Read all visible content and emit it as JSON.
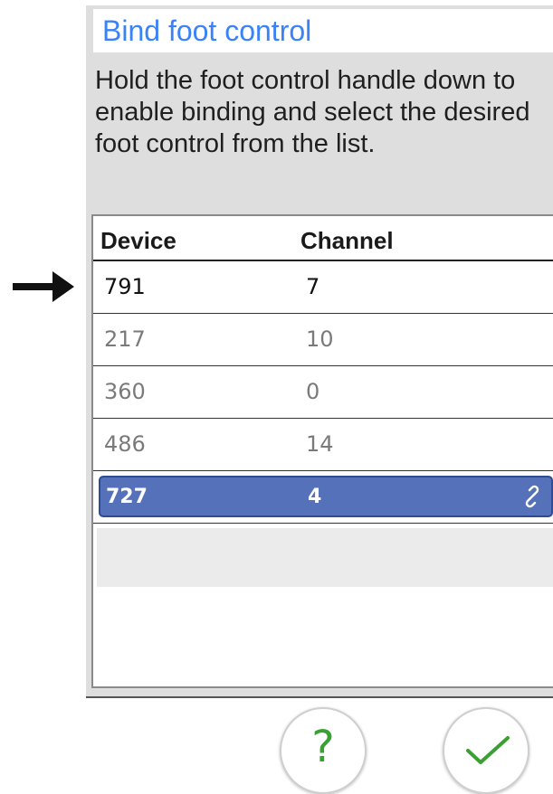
{
  "dialog": {
    "title": "Bind foot control",
    "instructions": "Hold the foot control handle down to enable binding and select the desired foot control from the list."
  },
  "table": {
    "columns": [
      "Device",
      "Channel"
    ],
    "rows": [
      {
        "device": "791",
        "channel": "7",
        "state": "active"
      },
      {
        "device": "217",
        "channel": "10",
        "state": "dim"
      },
      {
        "device": "360",
        "channel": "0",
        "state": "dim"
      },
      {
        "device": "486",
        "channel": "14",
        "state": "dim"
      },
      {
        "device": "727",
        "channel": "4",
        "state": "selected",
        "icon": "link-icon"
      }
    ]
  },
  "buttons": {
    "help_label": "?",
    "confirm_icon": "checkmark-icon"
  },
  "annotation": {
    "icon": "right-arrow-icon"
  },
  "colors": {
    "title": "#3b82f6",
    "selected_row": "#5571b9",
    "accent_green": "#3aa033",
    "dialog_bg": "#dedede"
  }
}
